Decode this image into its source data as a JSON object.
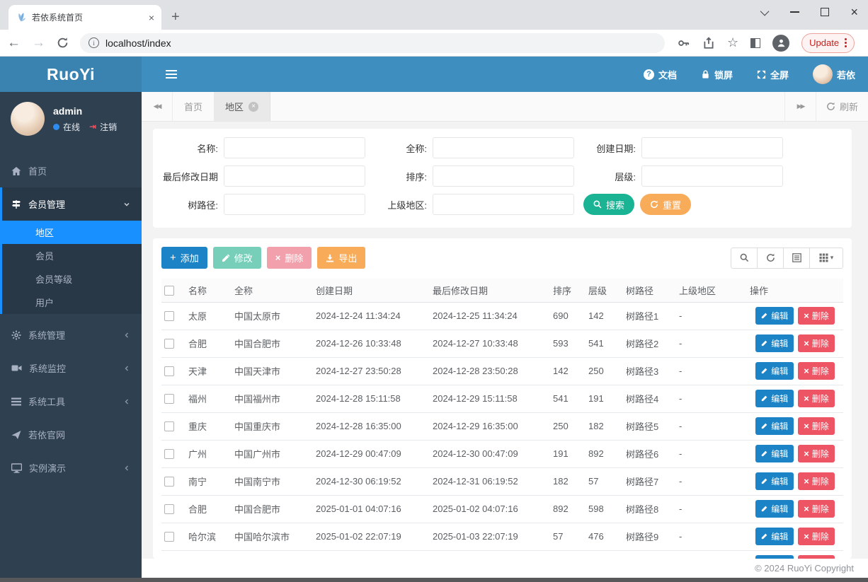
{
  "browser": {
    "tab_title": "若依系统首页",
    "url": "localhost/index",
    "update_label": "Update"
  },
  "header": {
    "logo": "RuoYi",
    "doc": "文档",
    "lock": "锁屏",
    "fullscreen": "全屏",
    "username": "若依"
  },
  "sidebar": {
    "user": {
      "name": "admin",
      "online": "在线",
      "logout": "注销"
    },
    "home": "首页",
    "member_mgmt": "会员管理",
    "member_children": {
      "region": "地区",
      "member": "会员",
      "level": "会员等级",
      "user": "用户"
    },
    "system_mgmt": "系统管理",
    "system_monitor": "系统监控",
    "system_tools": "系统工具",
    "official_site": "若依官网",
    "demo": "实例演示"
  },
  "tabbar": {
    "home_tab": "首页",
    "region_tab": "地区",
    "refresh": "刷新"
  },
  "search": {
    "name_label": "名称:",
    "fullname_label": "全称:",
    "created_label": "创建日期:",
    "modified_label": "最后修改日期",
    "sort_label": "排序:",
    "level_label": "层级:",
    "tree_label": "树路径:",
    "parent_label": "上级地区:",
    "search_btn": "搜索",
    "reset_btn": "重置"
  },
  "toolbar": {
    "add": "添加",
    "edit": "修改",
    "delete": "删除",
    "export": "导出"
  },
  "table": {
    "columns": [
      "名称",
      "全称",
      "创建日期",
      "最后修改日期",
      "排序",
      "层级",
      "树路径",
      "上级地区",
      "操作"
    ],
    "edit_label": "编辑",
    "delete_label": "删除",
    "rows": [
      {
        "name": "太原",
        "full_name": "中国太原市",
        "created": "2024-12-24 11:34:24",
        "modified": "2024-12-25 11:34:24",
        "sort": "690",
        "level": "142",
        "tree_path": "树路径1",
        "parent": "-"
      },
      {
        "name": "合肥",
        "full_name": "中国合肥市",
        "created": "2024-12-26 10:33:48",
        "modified": "2024-12-27 10:33:48",
        "sort": "593",
        "level": "541",
        "tree_path": "树路径2",
        "parent": "-"
      },
      {
        "name": "天津",
        "full_name": "中国天津市",
        "created": "2024-12-27 23:50:28",
        "modified": "2024-12-28 23:50:28",
        "sort": "142",
        "level": "250",
        "tree_path": "树路径3",
        "parent": "-"
      },
      {
        "name": "福州",
        "full_name": "中国福州市",
        "created": "2024-12-28 15:11:58",
        "modified": "2024-12-29 15:11:58",
        "sort": "541",
        "level": "191",
        "tree_path": "树路径4",
        "parent": "-"
      },
      {
        "name": "重庆",
        "full_name": "中国重庆市",
        "created": "2024-12-28 16:35:00",
        "modified": "2024-12-29 16:35:00",
        "sort": "250",
        "level": "182",
        "tree_path": "树路径5",
        "parent": "-"
      },
      {
        "name": "广州",
        "full_name": "中国广州市",
        "created": "2024-12-29 00:47:09",
        "modified": "2024-12-30 00:47:09",
        "sort": "191",
        "level": "892",
        "tree_path": "树路径6",
        "parent": "-"
      },
      {
        "name": "南宁",
        "full_name": "中国南宁市",
        "created": "2024-12-30 06:19:52",
        "modified": "2024-12-31 06:19:52",
        "sort": "182",
        "level": "57",
        "tree_path": "树路径7",
        "parent": "-"
      },
      {
        "name": "合肥",
        "full_name": "中国合肥市",
        "created": "2025-01-01 04:07:16",
        "modified": "2025-01-02 04:07:16",
        "sort": "892",
        "level": "598",
        "tree_path": "树路径8",
        "parent": "-"
      },
      {
        "name": "哈尔滨",
        "full_name": "中国哈尔滨市",
        "created": "2025-01-02 22:07:19",
        "modified": "2025-01-03 22:07:19",
        "sort": "57",
        "level": "476",
        "tree_path": "树路径9",
        "parent": "-"
      },
      {
        "name": "",
        "full_name": "",
        "created": "",
        "modified": "",
        "sort": "",
        "level": "",
        "tree_path": "",
        "parent": ""
      }
    ]
  },
  "footer": {
    "copyright": "© 2024 RuoYi Copyright"
  },
  "colors": {
    "navbar": "#3e8fc0",
    "sidebar": "#2f4050",
    "active_menu": "#1890ff",
    "primary": "#1c84c6",
    "success": "#1ab394",
    "danger": "#ed5565",
    "warning": "#f8ac59"
  }
}
